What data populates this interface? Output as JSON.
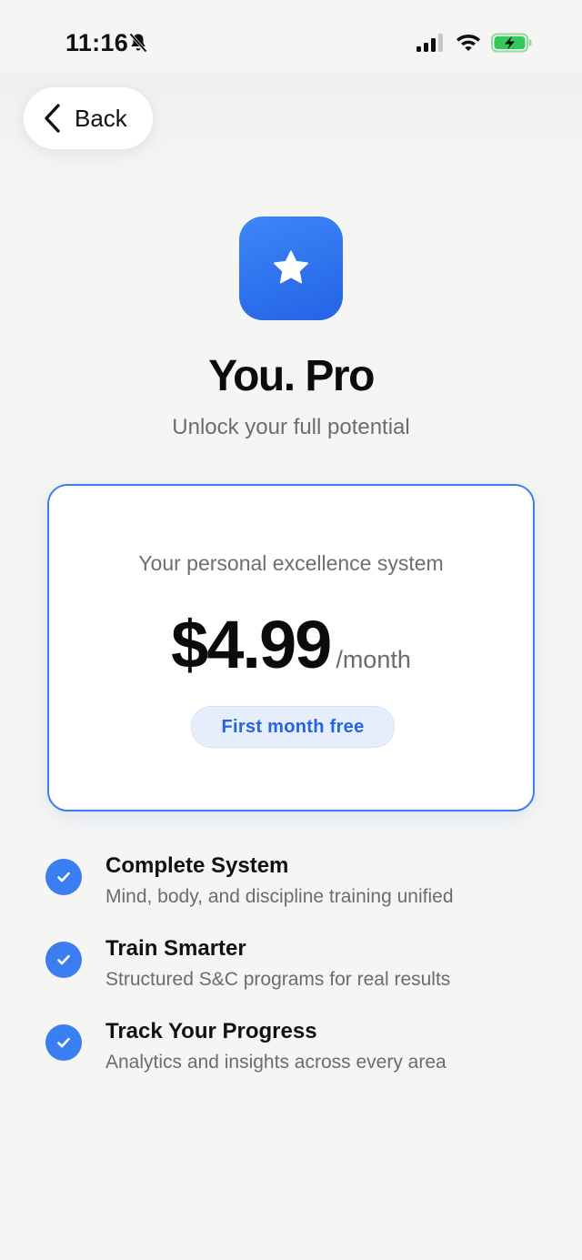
{
  "status_bar": {
    "time": "11:16",
    "icons": [
      "bell-slash-icon",
      "cellular-signal-icon",
      "wifi-icon",
      "battery-charging-icon"
    ]
  },
  "nav": {
    "back_label": "Back"
  },
  "header": {
    "app_icon": "star-icon",
    "title": "You. Pro",
    "tagline": "Unlock your full potential"
  },
  "plan": {
    "subtitle": "Your personal excellence system",
    "price": "$4.99",
    "period": "/month",
    "promo": "First month free"
  },
  "features": [
    {
      "title": "Complete System",
      "description": "Mind, body, and discipline training unified"
    },
    {
      "title": "Train Smarter",
      "description": "Structured S&C programs for real results"
    },
    {
      "title": "Track Your Progress",
      "description": "Analytics and insights across every area"
    }
  ],
  "colors": {
    "accent": "#3a7ef2",
    "background": "#f5f5f3",
    "battery": "#34c759"
  }
}
